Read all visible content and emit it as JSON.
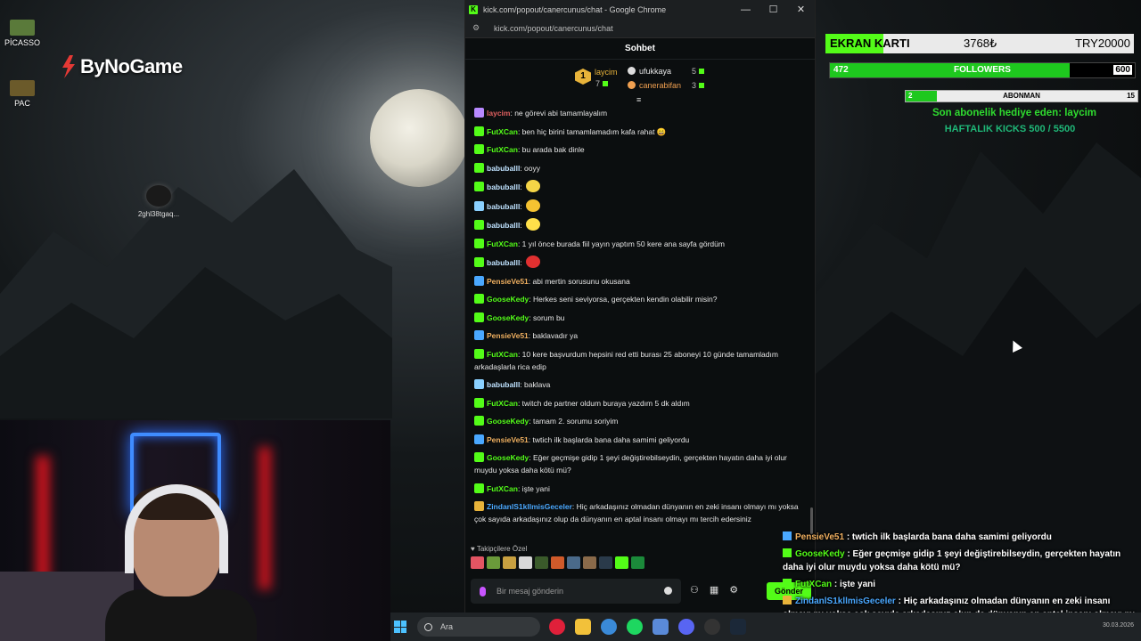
{
  "desktop": {
    "icons": [
      {
        "label": "PİCASSO",
        "color": "#5a7a3a"
      },
      {
        "label": "PAC",
        "color": "#6b5a2a"
      }
    ],
    "logo_text": "ByNoGame",
    "file_icon_label": "2ghl38tgaq..."
  },
  "browser": {
    "window_title": "kick.com/popout/canercunus/chat - Google Chrome",
    "url": "kick.com/popout/canercunus/chat",
    "buttons": {
      "minimize": "—",
      "maximize": "☐",
      "close": "✕"
    }
  },
  "chat": {
    "header": "Sohbet",
    "leaderboard": {
      "first": {
        "rank": "1",
        "name": "laycim",
        "count": "7"
      },
      "second": {
        "name": "ufukkaya",
        "count": "5"
      },
      "third": {
        "name": "canerabifan",
        "count": "3"
      }
    },
    "messages": [
      {
        "user": "laycim",
        "text": ": ne görevi abi tamamlayalım",
        "color": "#e06060",
        "badge": "#b889ff"
      },
      {
        "user": "FutXCan",
        "text": ": ben hiç birini tamamlamadım kafa rahat 😄",
        "color": "#53fc18",
        "badge": "#53fc18"
      },
      {
        "user": "FutXCan",
        "text": ": bu arada bak dinle",
        "color": "#53fc18",
        "badge": "#53fc18"
      },
      {
        "user": "babuballl",
        "text": ": ooyy",
        "color": "#bfe2ff",
        "badge": "#53fc18"
      },
      {
        "user": "babuballl",
        "text": ":",
        "color": "#bfe2ff",
        "badge": "#53fc18",
        "emote": "#f5d547"
      },
      {
        "user": "babuballl",
        "text": ":",
        "color": "#bfe2ff",
        "badge": "#8ad0ff",
        "emote": "#f5c231"
      },
      {
        "user": "babuballl",
        "text": ":",
        "color": "#bfe2ff",
        "badge": "#53fc18",
        "emote": "#ffe04a"
      },
      {
        "user": "FutXCan",
        "text": ": 1 yıl önce burada fiil yayın yaptım 50 kere ana sayfa gördüm",
        "color": "#53fc18",
        "badge": "#53fc18"
      },
      {
        "user": "babuballl",
        "text": ":",
        "color": "#bfe2ff",
        "badge": "#53fc18",
        "emote": "#e03030"
      },
      {
        "user": "PensieVe51",
        "text": ": abi mertin sorusunu okusana",
        "color": "#f0b060",
        "badge": "#4aa8ff"
      },
      {
        "user": "GooseKedy",
        "text": ": Herkes seni seviyorsa, gerçekten kendin olabilir misin?",
        "color": "#53fc18",
        "badge": "#53fc18"
      },
      {
        "user": "GooseKedy",
        "text": ": sorum bu",
        "color": "#53fc18",
        "badge": "#53fc18"
      },
      {
        "user": "PensieVe51",
        "text": ": baklavadır ya",
        "color": "#f0b060",
        "badge": "#4aa8ff"
      },
      {
        "user": "FutXCan",
        "text": ": 10 kere başvurdum hepsini red etti burası 25 aboneyi 10 günde tamamladım arkadaşlarla rica edip",
        "color": "#53fc18",
        "badge": "#53fc18"
      },
      {
        "user": "babuballl",
        "text": ": baklava",
        "color": "#bfe2ff",
        "badge": "#8ad0ff"
      },
      {
        "user": "FutXCan",
        "text": ": twitch de partner oldum buraya yazdım 5 dk aldım",
        "color": "#53fc18",
        "badge": "#53fc18"
      },
      {
        "user": "GooseKedy",
        "text": ": tamam 2. sorumu soriyim",
        "color": "#53fc18",
        "badge": "#53fc18"
      },
      {
        "user": "PensieVe51",
        "text": ": twtich ilk başlarda bana daha samimi geliyordu",
        "color": "#f0b060",
        "badge": "#4aa8ff"
      },
      {
        "user": "GooseKedy",
        "text": ": Eğer geçmişe gidip 1 şeyi değiştirebilseydin, gerçekten hayatın daha iyi olur muydu yoksa daha kötü mü?",
        "color": "#53fc18",
        "badge": "#53fc18"
      },
      {
        "user": "FutXCan",
        "text": ": işte yani",
        "color": "#53fc18",
        "badge": "#53fc18"
      },
      {
        "user": "ZindanlS1kllmisGeceler",
        "text": ": Hiç arkadaşınız olmadan dünyanın en zeki insanı olmayı mı yoksa çok sayıda arkadaşınız olup da dünyanın en aptal insanı olmayı mı tercih edersiniz",
        "color": "#4aa8ff",
        "badge": "#e8b33a"
      }
    ],
    "emote_bar_label": "Takipçilere Özel",
    "input_placeholder": "Bir mesaj gönderin",
    "send_label": "Gönder"
  },
  "overlay": {
    "gpu_goal": {
      "label": "EKRAN KARTI",
      "current": "3768₺",
      "target": "TRY20000",
      "progress": 0.188
    },
    "followers": {
      "current": "472",
      "label": "FOLLOWERS",
      "target": "600",
      "progress": 0.787
    },
    "subs": {
      "current": "2",
      "label": "ABONMAN",
      "target": "15",
      "progress": 0.133
    },
    "gift_text": "Son abonelik hediye eden: laycim",
    "weekly_text": "HAFTALIK KICKS 500 / 5500",
    "chat_lines": [
      {
        "user": "PensieVe51",
        "text": " : twtich ilk başlarda bana daha samimi geliyordu",
        "color": "#f0b060",
        "badge": "#4aa8ff"
      },
      {
        "user": "GooseKedy",
        "text": " : Eğer geçmişe gidip 1 şeyi değiştirebilseydin, gerçekten hayatın daha iyi olur muydu yoksa daha kötü mü?",
        "color": "#53fc18",
        "badge": "#53fc18"
      },
      {
        "user": "FutXCan",
        "text": " : işte yani",
        "color": "#53fc18",
        "badge": "#53fc18"
      },
      {
        "user": "ZindanlS1kllmisGeceler",
        "text": " : Hiç arkadaşınız olmadan dünyanın en zeki insanı olmayı mı yoksa çok sayıda arkadaşınız olup da dünyanın en aptal insanı olmayı mı tercih edersiniz",
        "color": "#4aa8ff",
        "badge": "#e8b33a"
      }
    ]
  },
  "taskbar": {
    "search_placeholder": "Ara",
    "date": "30.03.2026"
  }
}
